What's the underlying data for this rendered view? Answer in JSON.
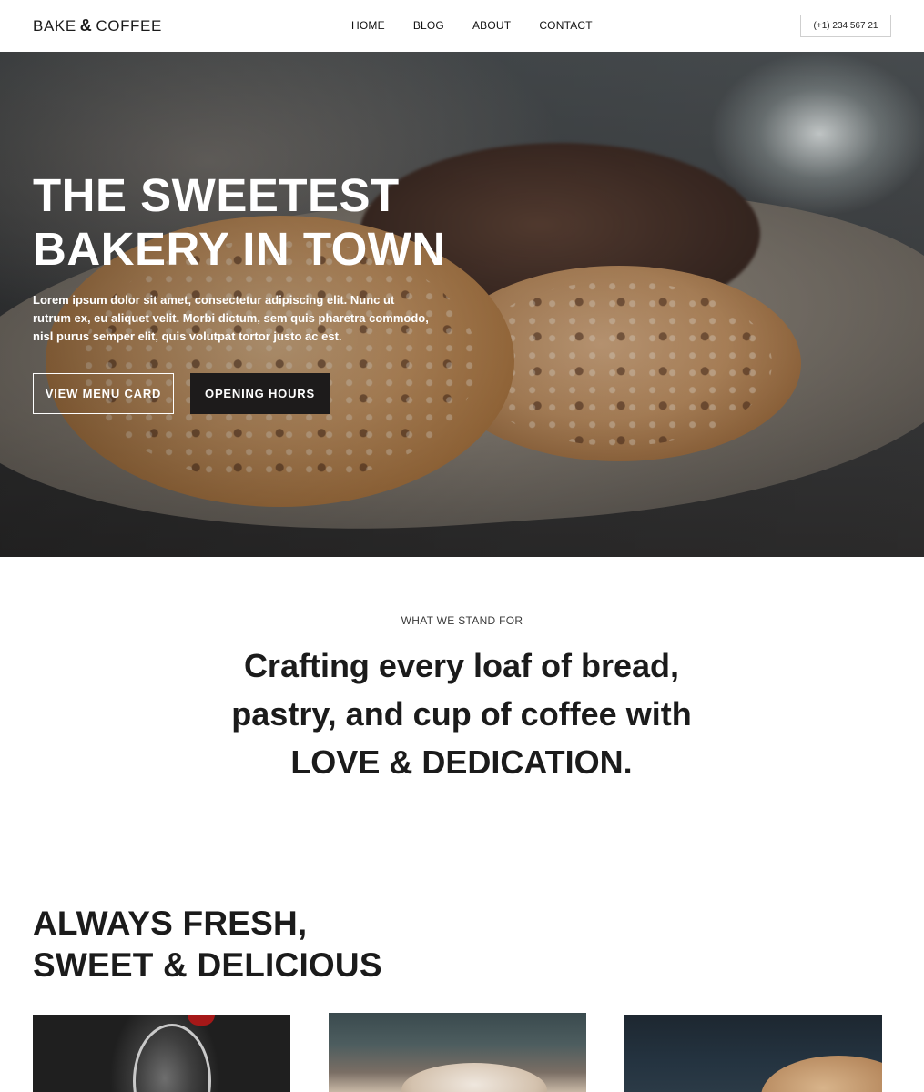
{
  "header": {
    "logo": {
      "part1": "BAKE",
      "amp": "&",
      "part2": "COFFEE"
    },
    "nav": [
      "HOME",
      "BLOG",
      "ABOUT",
      "CONTACT"
    ],
    "phone": "(+1) 234 567 21"
  },
  "hero": {
    "title_line1": "THE SWEETEST",
    "title_line2": "BAKERY IN TOWN",
    "text": "Lorem ipsum dolor sit amet, consectetur adipiscing elit. Nunc ut rutrum ex, eu aliquet velit. Morbi dictum, sem quis pharetra commodo, nisl purus semper elit, quis volutpat tortor justo ac est.",
    "button_menu": "VIEW MENU CARD",
    "button_hours": "OPENING HOURS"
  },
  "values": {
    "eyebrow": "WHAT WE STAND FOR",
    "line1": "Crafting every loaf of bread,",
    "line2": "pastry, and cup of coffee with",
    "line3": "LOVE & DEDICATION."
  },
  "fresh": {
    "title_line1": "ALWAYS FRESH,",
    "title_line2": "SWEET & DELICIOUS"
  },
  "colors": {
    "dark_button": "#1d1b1b",
    "text": "#1b1b1b",
    "divider": "#dddddd"
  }
}
